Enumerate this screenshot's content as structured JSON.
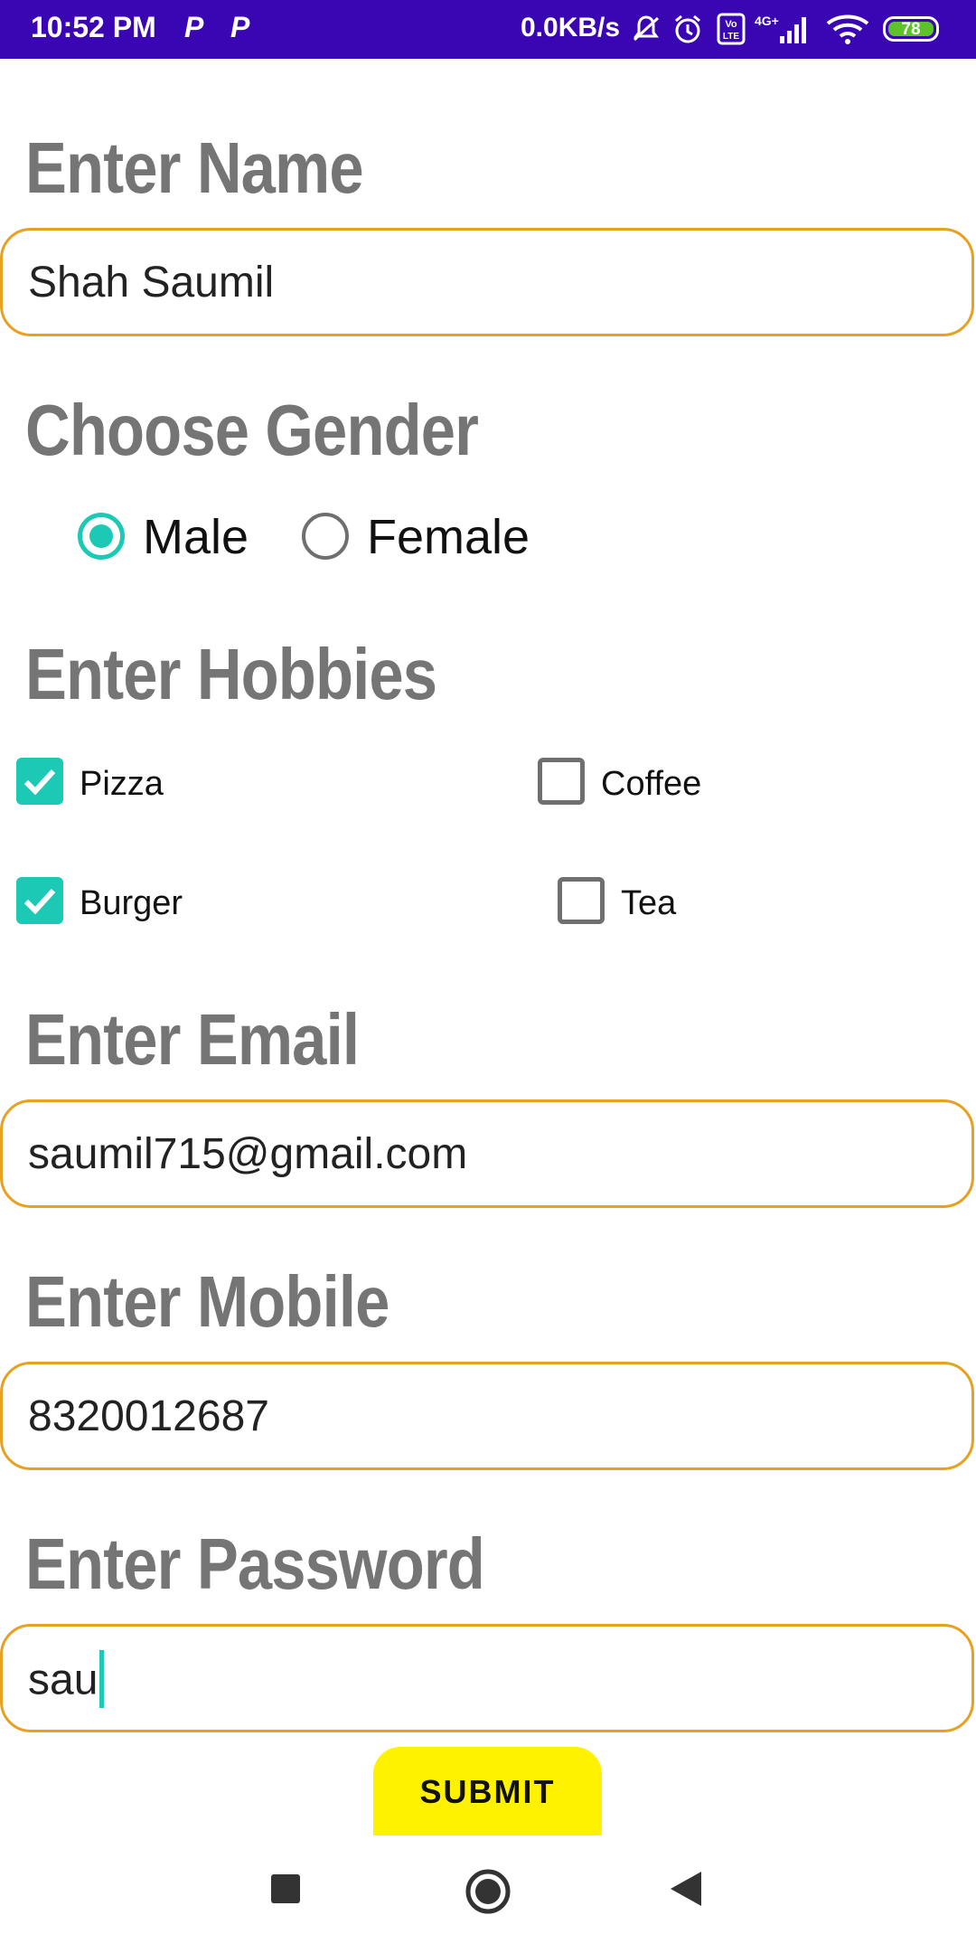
{
  "status_bar": {
    "time": "10:52 PM",
    "notif_icon_1": "P",
    "notif_icon_2": "P",
    "network_speed": "0.0KB/s",
    "battery_level": "78",
    "icons": [
      "bell-off-icon",
      "alarm-icon",
      "volte-icon",
      "4g-signal-icon",
      "wifi-icon",
      "battery-icon"
    ]
  },
  "form": {
    "name_title": "Enter Name",
    "name_value": "Shah Saumil",
    "gender_title": "Choose Gender",
    "gender_options": [
      {
        "label": "Male",
        "selected": true
      },
      {
        "label": "Female",
        "selected": false
      }
    ],
    "hobbies_title": "Enter Hobbies",
    "hobbies": [
      {
        "label": "Pizza",
        "checked": true
      },
      {
        "label": "Coffee",
        "checked": false
      },
      {
        "label": "Burger",
        "checked": true
      },
      {
        "label": "Tea",
        "checked": false
      }
    ],
    "email_title": "Enter Email",
    "email_value": "saumil715@gmail.com",
    "mobile_title": "Enter Mobile",
    "mobile_value": "8320012687",
    "password_title": "Enter Password",
    "password_value": "sau",
    "submit_label": "SUBMIT"
  },
  "colors": {
    "status_bar": "#3a06b4",
    "accent": "#1cc9b4",
    "field_border": "#e8a020",
    "title_gray": "#757575",
    "submit_bg": "#fff200"
  },
  "navbar": {
    "icons": [
      "recents-square-icon",
      "home-circle-icon",
      "back-triangle-icon"
    ]
  }
}
